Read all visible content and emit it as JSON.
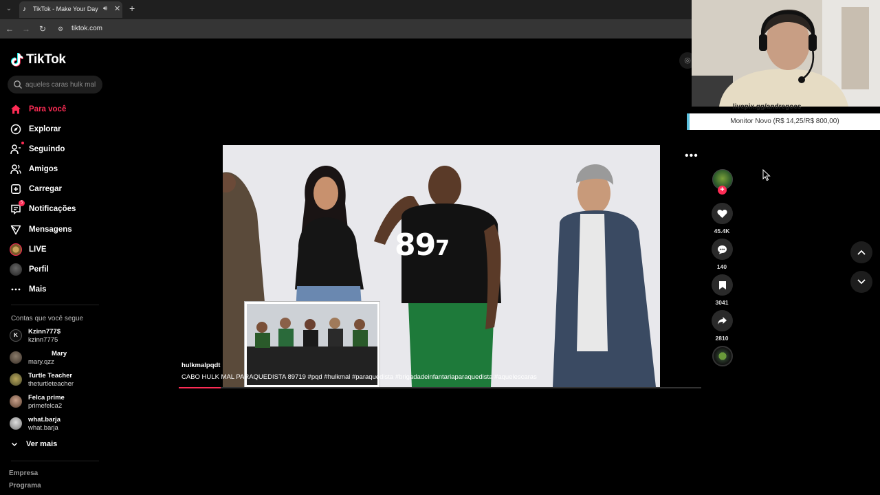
{
  "browser": {
    "tab_title": "TikTok - Make Your Day",
    "url": "tiktok.com"
  },
  "sidebar": {
    "logo_text": "TikTok",
    "search_placeholder": "aqueles caras hulk mal",
    "nav": [
      {
        "label": "Para você",
        "icon": "home-icon",
        "active": true
      },
      {
        "label": "Explorar",
        "icon": "compass-icon"
      },
      {
        "label": "Seguindo",
        "icon": "following-icon"
      },
      {
        "label": "Amigos",
        "icon": "friends-icon"
      },
      {
        "label": "Carregar",
        "icon": "upload-icon"
      },
      {
        "label": "Notificações",
        "icon": "inbox-icon",
        "badge": "5"
      },
      {
        "label": "Mensagens",
        "icon": "send-icon"
      },
      {
        "label": "LIVE",
        "icon": "live-icon"
      },
      {
        "label": "Perfil",
        "icon": "profile-icon"
      },
      {
        "label": "Mais",
        "icon": "more-icon"
      }
    ],
    "following_title": "Contas que você segue",
    "accounts": [
      {
        "name": "Kzinn777$",
        "handle": "kzinn7775"
      },
      {
        "name": "Mary",
        "handle": "mary.qzz"
      },
      {
        "name": "Turtle Teacher",
        "handle": "theturtleteacher"
      },
      {
        "name": "Felca prime",
        "handle": "primefelca2"
      },
      {
        "name": "what.barja",
        "handle": "what.barja"
      }
    ],
    "see_more": "Ver mais",
    "footer": [
      "Empresa",
      "Programa"
    ]
  },
  "video": {
    "overlay_number": "89",
    "overlay_number_small": "7",
    "author": "hulkmalpqdt",
    "caption": "CABO HULK MAL PARAQUEDISTA 89719 #pqd  #hulkmal  #paraquedista  #brigadadeinfantariaparaquedista  #aquelescaras",
    "progress": 0.08
  },
  "actions": {
    "likes": "45.4K",
    "comments": "140",
    "saves": "3041",
    "shares": "2810"
  },
  "stream_overlay": {
    "handle": "livepix.gg/andregoes",
    "donation": "Monitor Novo (R$ 14,25/R$ 800,00)"
  },
  "colors": {
    "accent": "#fe2c55",
    "background": "#000000"
  }
}
